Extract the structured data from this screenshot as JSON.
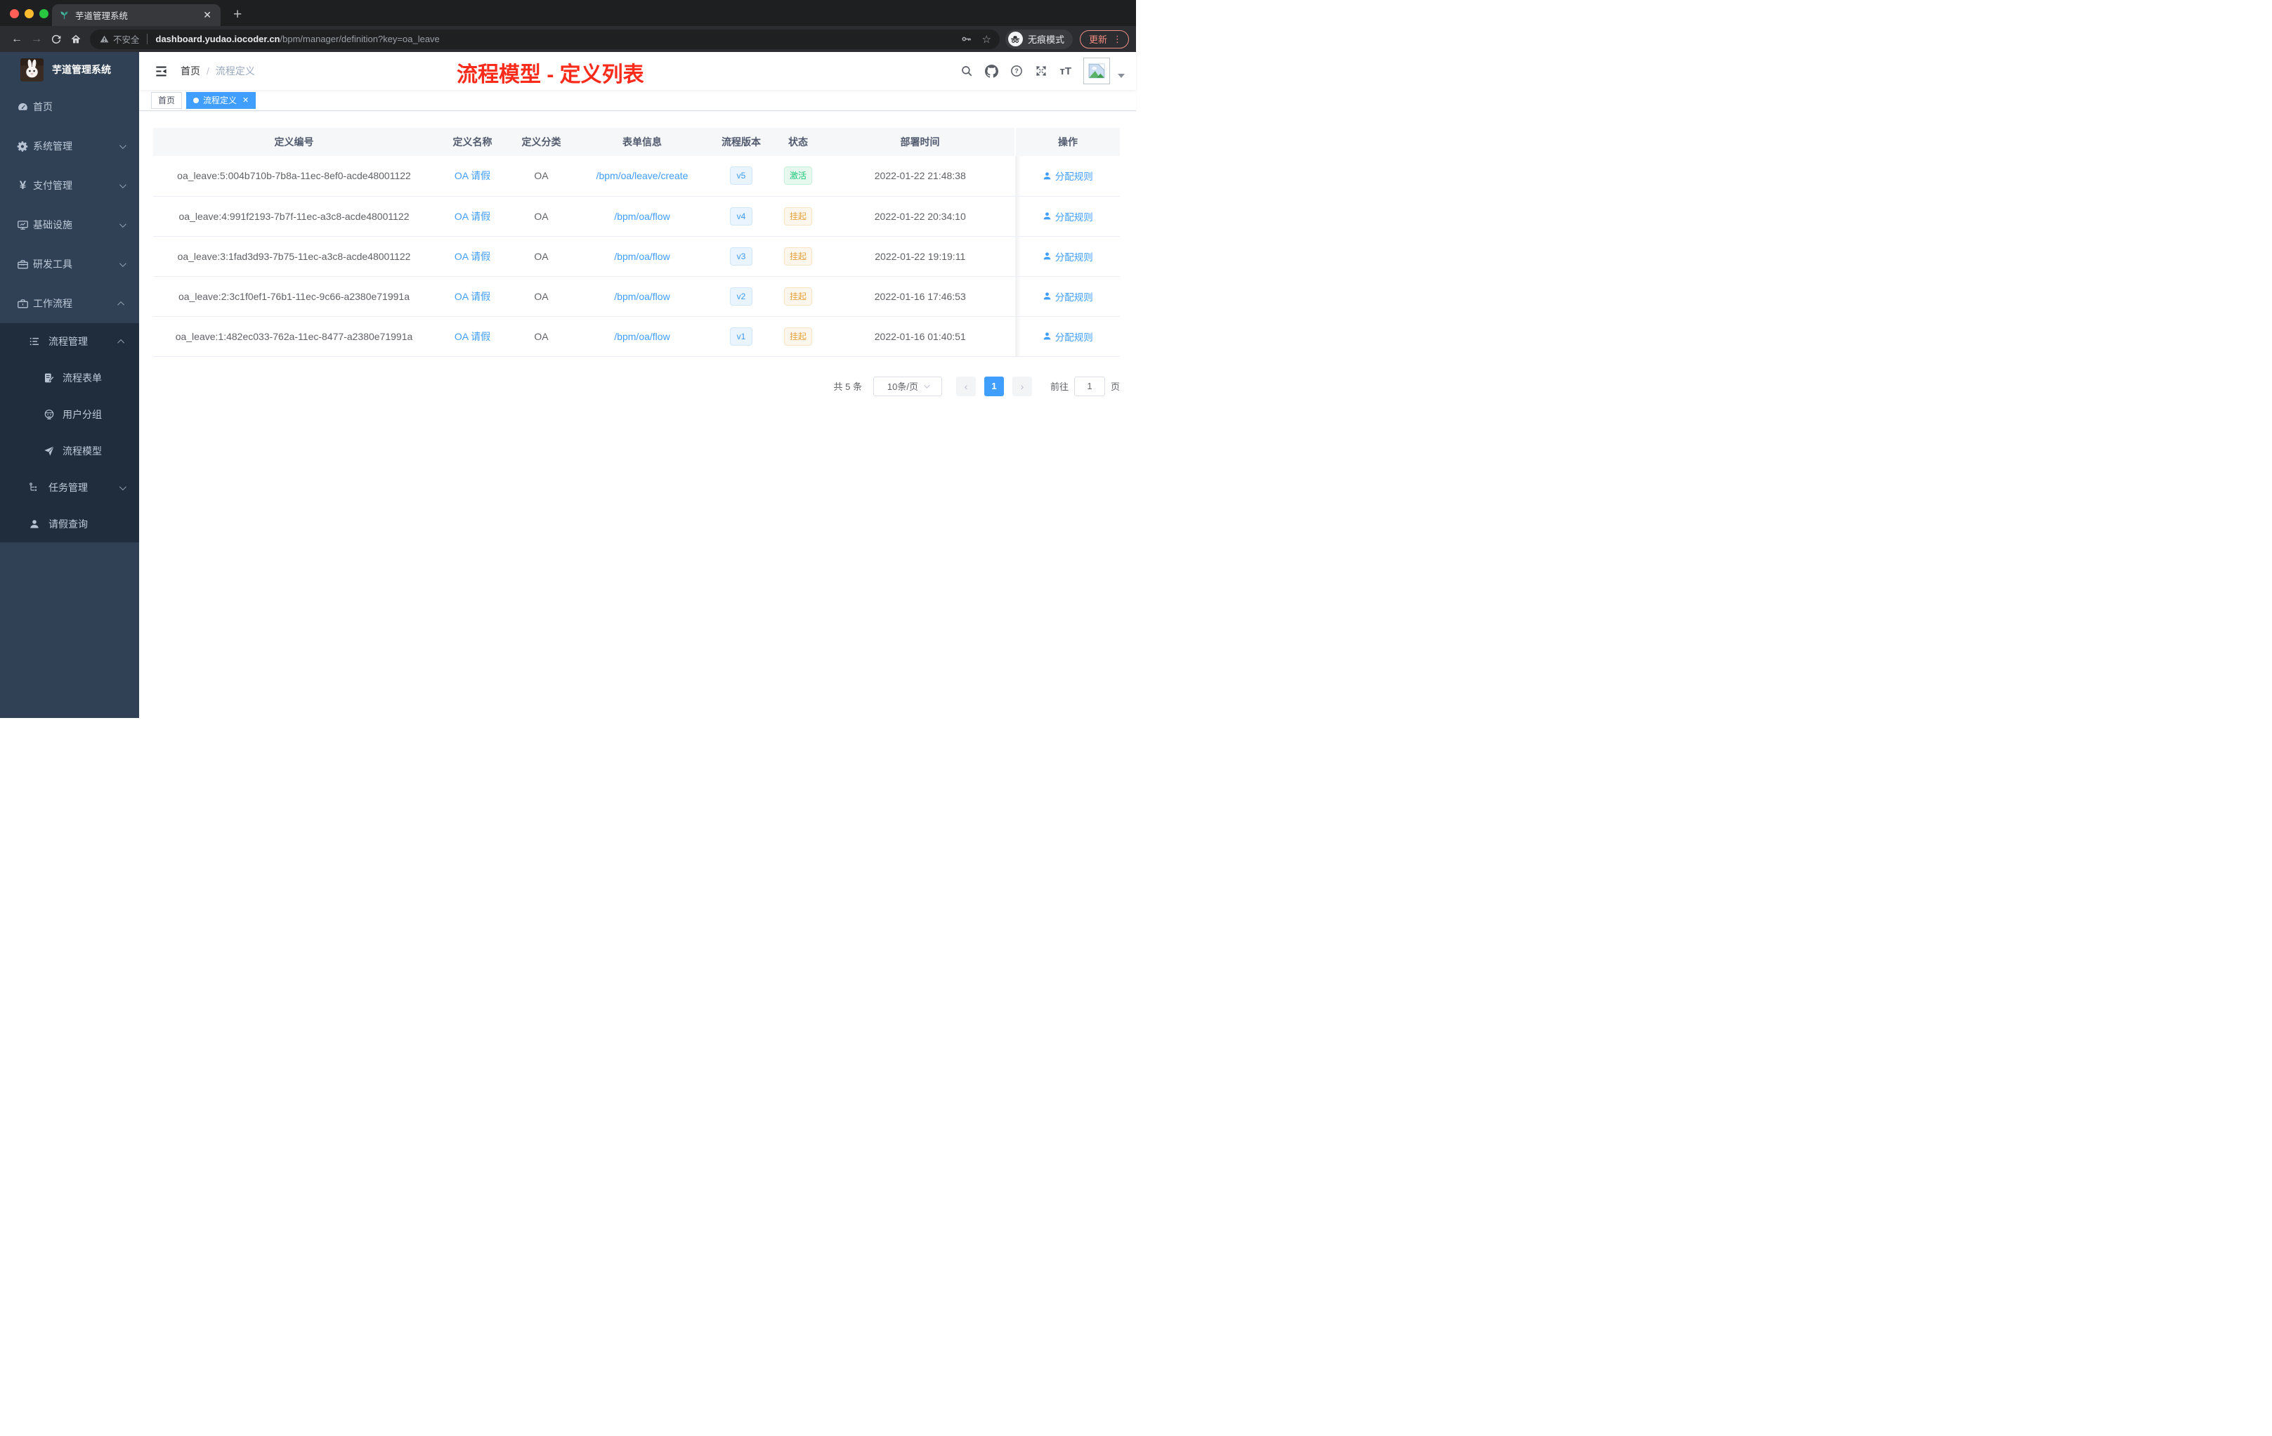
{
  "colors": {
    "primary": "#409eff",
    "annotation_red": "#fb2b1b",
    "success_text": "#1dc779",
    "warning_text": "#e6a23c",
    "sidebar_bg": "#304156",
    "submenu_bg": "#1f2d3d"
  },
  "browser": {
    "tab_title": "芋道管理系统",
    "security": "不安全",
    "host": "dashboard.yudao.iocoder.cn",
    "path": "/bpm/manager/definition?key=oa_leave",
    "incognito": "无痕模式",
    "update": "更新"
  },
  "sidebar": {
    "title": "芋道管理系统",
    "menu": [
      {
        "label": "首页"
      },
      {
        "label": "系统管理"
      },
      {
        "label": "支付管理"
      },
      {
        "label": "基础设施"
      },
      {
        "label": "研发工具"
      },
      {
        "label": "工作流程",
        "children": [
          {
            "label": "流程管理",
            "children": [
              {
                "label": "流程表单"
              },
              {
                "label": "用户分组"
              },
              {
                "label": "流程模型"
              }
            ]
          },
          {
            "label": "任务管理"
          },
          {
            "label": "请假查询"
          }
        ]
      }
    ]
  },
  "header": {
    "breadcrumb": [
      "首页",
      "流程定义"
    ],
    "annotation": "流程模型 - 定义列表"
  },
  "tags": {
    "items": [
      {
        "label": "首页"
      },
      {
        "label": "流程定义"
      }
    ]
  },
  "table": {
    "columns": [
      "定义编号",
      "定义名称",
      "定义分类",
      "表单信息",
      "流程版本",
      "状态",
      "部署时间",
      "操作"
    ],
    "rows": [
      {
        "id": "oa_leave:5:004b710b-7b8a-11ec-8ef0-acde48001122",
        "name": "OA 请假",
        "category": "OA",
        "form": "/bpm/oa/leave/create",
        "version": "v5",
        "status": "激活",
        "time": "2022-01-22 21:48:38",
        "action": "分配规则"
      },
      {
        "id": "oa_leave:4:991f2193-7b7f-11ec-a3c8-acde48001122",
        "name": "OA 请假",
        "category": "OA",
        "form": "/bpm/oa/flow",
        "version": "v4",
        "status": "挂起",
        "time": "2022-01-22 20:34:10",
        "action": "分配规则"
      },
      {
        "id": "oa_leave:3:1fad3d93-7b75-11ec-a3c8-acde48001122",
        "name": "OA 请假",
        "category": "OA",
        "form": "/bpm/oa/flow",
        "version": "v3",
        "status": "挂起",
        "time": "2022-01-22 19:19:11",
        "action": "分配规则"
      },
      {
        "id": "oa_leave:2:3c1f0ef1-76b1-11ec-9c66-a2380e71991a",
        "name": "OA 请假",
        "category": "OA",
        "form": "/bpm/oa/flow",
        "version": "v2",
        "status": "挂起",
        "time": "2022-01-16 17:46:53",
        "action": "分配规则"
      },
      {
        "id": "oa_leave:1:482ec033-762a-11ec-8477-a2380e71991a",
        "name": "OA 请假",
        "category": "OA",
        "form": "/bpm/oa/flow",
        "version": "v1",
        "status": "挂起",
        "time": "2022-01-16 01:40:51",
        "action": "分配规则"
      }
    ]
  },
  "pagination": {
    "total": "共 5 条",
    "page_size": "10条/页",
    "page": "1",
    "goto": "前往",
    "goto_value": "1",
    "unit": "页"
  }
}
